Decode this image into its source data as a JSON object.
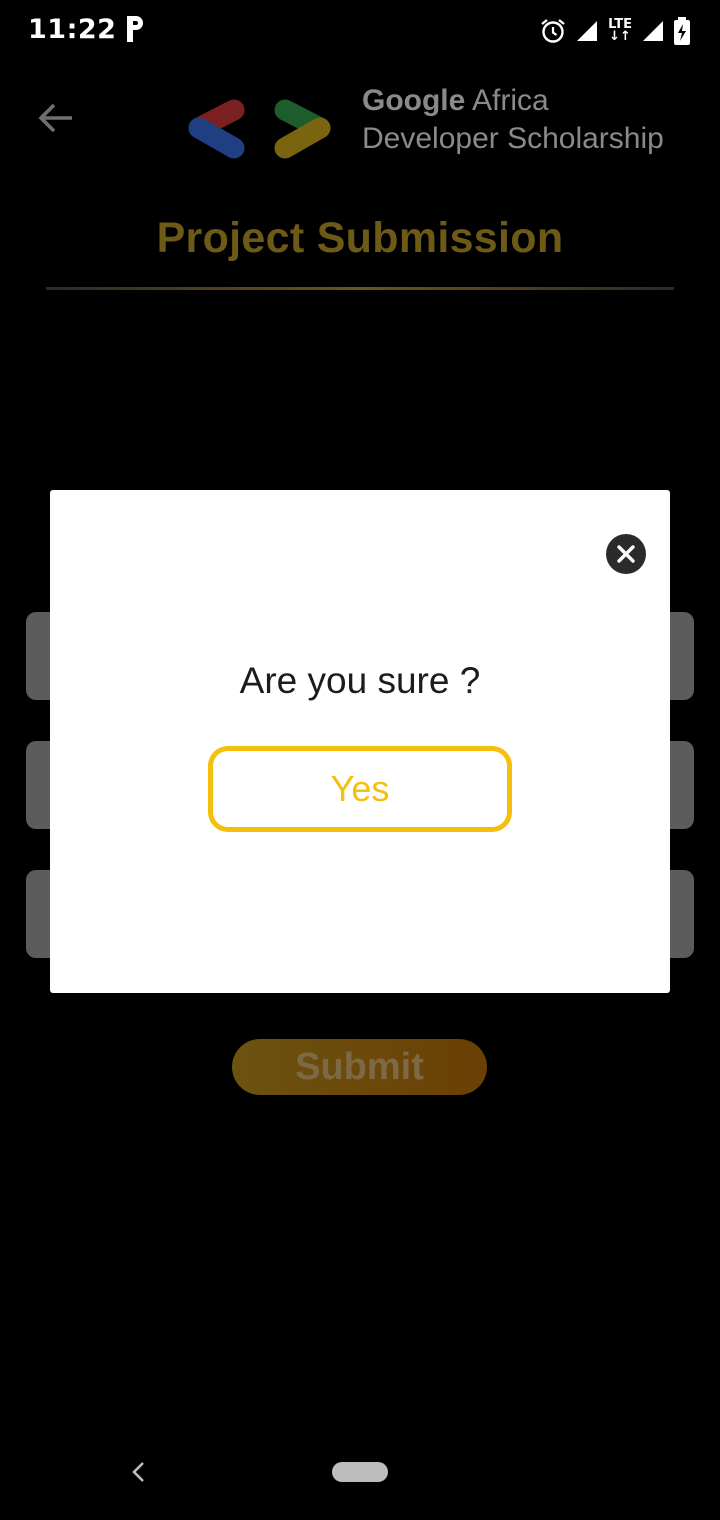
{
  "status_bar": {
    "time": "11:22",
    "network_label": "LTE",
    "icons": [
      "parking-icon",
      "alarm-icon",
      "signal-icon",
      "battery-icon"
    ]
  },
  "header": {
    "brand_google": "Google",
    "brand_africa": " Africa",
    "brand_line2": "Developer Scholarship",
    "title": "Project Submission"
  },
  "form": {
    "field_1_text": "",
    "field_2_text": "",
    "field_3_text": "",
    "submit_label": "Submit"
  },
  "dialog": {
    "question": "Are you sure ?",
    "confirm_label": "Yes"
  },
  "colors": {
    "accent": "#f5bf0d",
    "title_dimmed": "#6e5a17",
    "dialog_bg": "#ffffff",
    "overlay_bg": "#000000"
  }
}
